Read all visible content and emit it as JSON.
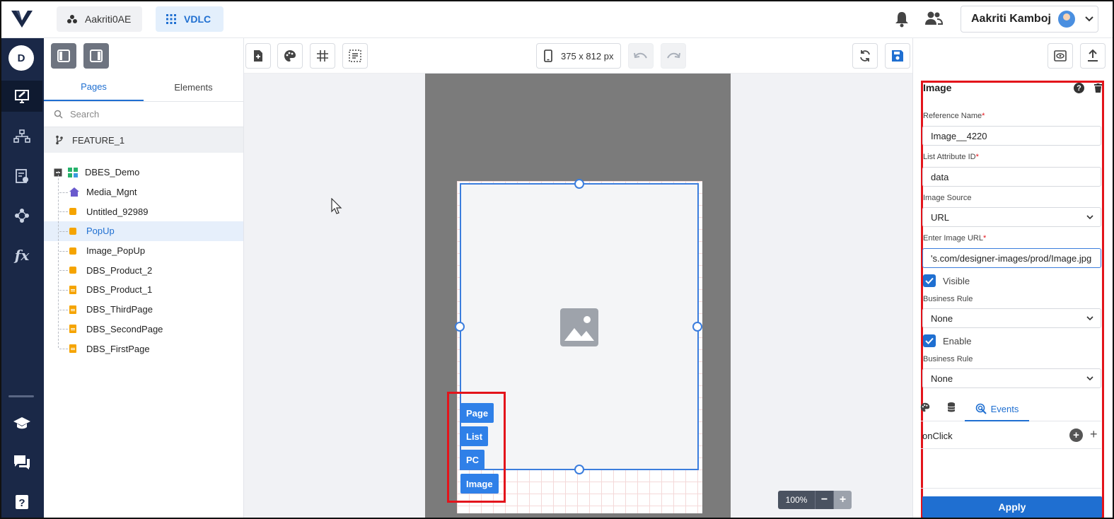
{
  "topbar": {
    "workspace": "Aakriti0AE",
    "app": "VDLC",
    "user_name": "Aakriti Kamboj"
  },
  "rail": {
    "avatar_letter": "D",
    "icons": [
      "designer-icon",
      "flow-icon",
      "settings-doc-icon",
      "network-icon",
      "function-icon",
      "learn-icon",
      "chat-icon",
      "help-icon"
    ]
  },
  "left_panel": {
    "tabs": [
      "Pages",
      "Elements"
    ],
    "active_tab": "Pages",
    "search_placeholder": "Search",
    "branch": "FEATURE_1",
    "tree": {
      "root": "DBES_Demo",
      "children": [
        {
          "label": "Media_Mgnt",
          "icon": "home-icon"
        },
        {
          "label": "Untitled_92989",
          "icon": "popup-icon"
        },
        {
          "label": "PopUp",
          "icon": "popup-icon",
          "selected": true
        },
        {
          "label": "Image_PopUp",
          "icon": "popup-icon"
        },
        {
          "label": "DBS_Product_2",
          "icon": "popup-icon"
        },
        {
          "label": "DBS_Product_1",
          "icon": "page-icon"
        },
        {
          "label": "DBS_ThirdPage",
          "icon": "page-icon"
        },
        {
          "label": "DBS_SecondPage",
          "icon": "page-icon"
        },
        {
          "label": "DBS_FirstPage",
          "icon": "page-icon"
        }
      ]
    }
  },
  "toolbar": {
    "device_size": "375 x 812 px"
  },
  "canvas": {
    "zoom": "100%",
    "tags": [
      "Page",
      "List",
      "PC",
      "Image"
    ]
  },
  "properties": {
    "title": "Image",
    "reference_name_label": "Reference Name",
    "reference_name_value": "Image__4220",
    "list_attr_label": "List Attribute ID",
    "list_attr_value": "data",
    "image_source_label": "Image Source",
    "image_source_value": "URL",
    "image_url_label": "Enter Image URL",
    "image_url_value": "'s.com/designer-images/prod/Image.jpg",
    "visible_label": "Visible",
    "visible_checked": true,
    "business_rule_label_1": "Business Rule",
    "business_rule_value_1": "None",
    "enable_label": "Enable",
    "enable_checked": true,
    "business_rule_label_2": "Business Rule",
    "business_rule_value_2": "None",
    "events_tab": "Events",
    "onclick_label": "onClick",
    "apply_label": "Apply"
  },
  "colors": {
    "accent": "#1f6fd1",
    "rail": "#1a2847",
    "highlight": "#e3141b"
  }
}
